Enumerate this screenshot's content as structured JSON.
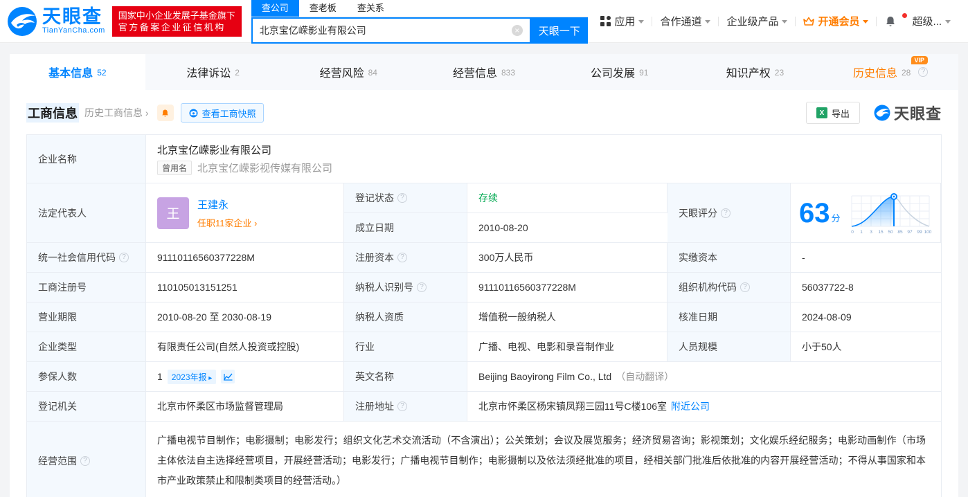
{
  "header": {
    "logo": {
      "title": "天眼查",
      "domain": "TianYanCha.com"
    },
    "badge_line1": "国家中小企业发展子基金旗下",
    "badge_line2": "官方备案企业征信机构",
    "search": {
      "tab_company": "查公司",
      "tab_boss": "查老板",
      "tab_relation": "查关系",
      "value": "北京宝亿嵘影业有限公司",
      "button": "天眼一下"
    },
    "nav": {
      "apps": "应用",
      "coop": "合作通道",
      "enterprise": "企业级产品",
      "vip": "开通会员",
      "super_vip": "超级..."
    }
  },
  "tabs": [
    {
      "label": "基本信息",
      "count": "52"
    },
    {
      "label": "法律诉讼",
      "count": "2"
    },
    {
      "label": "经营风险",
      "count": "84"
    },
    {
      "label": "经营信息",
      "count": "833"
    },
    {
      "label": "公司发展",
      "count": "91"
    },
    {
      "label": "知识产权",
      "count": "23"
    },
    {
      "label": "历史信息",
      "count": "28",
      "vip_badge": "VIP"
    }
  ],
  "section": {
    "title": "工商信息",
    "history_link": "历史工商信息",
    "snapshot_button": "查看工商快照",
    "export_button": "导出",
    "watermark": "天眼查"
  },
  "table": {
    "company_name": {
      "label": "企业名称",
      "value": "北京宝亿嵘影业有限公司",
      "former_badge": "曾用名",
      "former_name": "北京宝亿嵘影视传媒有限公司"
    },
    "legal_rep": {
      "label": "法定代表人",
      "avatar": "王",
      "name": "王建永",
      "link": "任职11家企业"
    },
    "reg_status": {
      "label": "登记状态",
      "value": "存续"
    },
    "est_date": {
      "label": "成立日期",
      "value": "2010-08-20"
    },
    "score": {
      "label": "天眼评分",
      "value": "63",
      "unit": "分",
      "axis_labels": [
        "0",
        "1",
        "3",
        "15",
        "50",
        "85",
        "97",
        "99",
        "100"
      ]
    },
    "credit_code": {
      "label": "统一社会信用代码",
      "value": "91110116560377228M"
    },
    "reg_capital": {
      "label": "注册资本",
      "value": "300万人民币"
    },
    "paid_capital": {
      "label": "实缴资本",
      "value": "-"
    },
    "reg_number": {
      "label": "工商注册号",
      "value": "110105013151251"
    },
    "taxpayer_id": {
      "label": "纳税人识别号",
      "value": "91110116560377228M"
    },
    "org_code": {
      "label": "组织机构代码",
      "value": "56037722-8"
    },
    "business_term": {
      "label": "营业期限",
      "value": "2010-08-20 至 2030-08-19"
    },
    "taxpayer_quality": {
      "label": "纳税人资质",
      "value": "增值税一般纳税人"
    },
    "approval_date": {
      "label": "核准日期",
      "value": "2024-08-09"
    },
    "company_type": {
      "label": "企业类型",
      "value": "有限责任公司(自然人投资或控股)"
    },
    "industry": {
      "label": "行业",
      "value": "广播、电视、电影和录音制作业"
    },
    "staff_size": {
      "label": "人员规模",
      "value": "小于50人"
    },
    "insured": {
      "label": "参保人数",
      "value": "1",
      "report_badge": "2023年报"
    },
    "english_name": {
      "label": "英文名称",
      "value": "Beijing Baoyirong Film Co., Ltd",
      "note": "（自动翻译）"
    },
    "reg_authority": {
      "label": "登记机关",
      "value": "北京市怀柔区市场监督管理局"
    },
    "reg_address": {
      "label": "注册地址",
      "value": "北京市怀柔区杨宋镇凤翔三园11号C楼106室",
      "nearby_link": "附近公司"
    },
    "business_scope": {
      "label": "经营范围",
      "value": "广播电视节目制作；电影摄制；电影发行；组织文化艺术交流活动（不含演出）；公关策划；会议及展览服务；经济贸易咨询；影视策划；文化娱乐经纪服务；电影动画制作（市场主体依法自主选择经营项目，开展经营活动；电影发行；广播电视节目制作；电影摄制以及依法须经批准的项目，经相关部门批准后依批准的内容开展经营活动；不得从事国家和本市产业政策禁止和限制类项目的经营活动。）"
    }
  },
  "chart_meta": {
    "type": "distribution-curve",
    "score": 63,
    "axis": [
      0,
      1,
      3,
      15,
      50,
      85,
      97,
      99,
      100
    ]
  },
  "colors": {
    "primary": "#0084ff",
    "orange": "#ff7d00",
    "green": "#00a850",
    "badge_red": "#e60012",
    "label_bg": "#f4f9fe"
  }
}
